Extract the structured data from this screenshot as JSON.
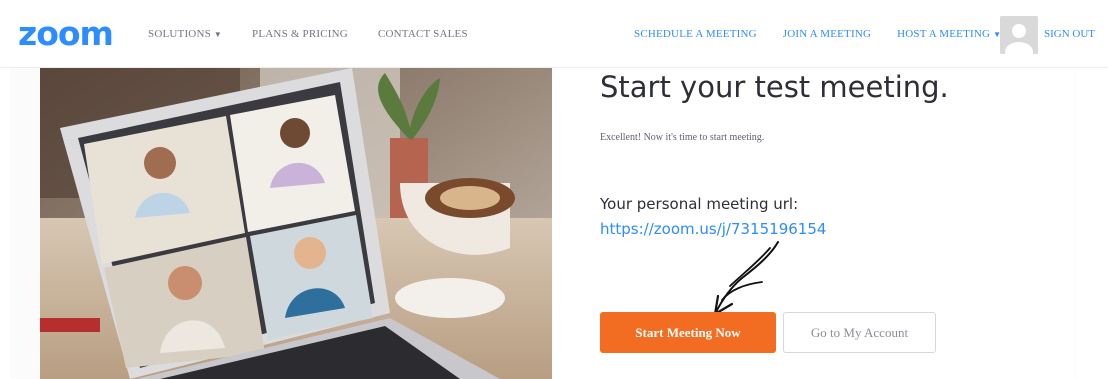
{
  "header": {
    "logo": "zoom",
    "nav_left": [
      {
        "label": "SOLUTIONS",
        "has_caret": true,
        "caret": "▼"
      },
      {
        "label": "PLANS & PRICING"
      },
      {
        "label": "CONTACT SALES"
      }
    ],
    "nav_right": [
      {
        "label": "SCHEDULE A MEETING"
      },
      {
        "label": "JOIN A MEETING"
      },
      {
        "label": "HOST A MEETING",
        "has_caret": true,
        "caret": "▼"
      }
    ],
    "sign_out": "SIGN OUT"
  },
  "main": {
    "title": "Start your test meeting.",
    "subtitle": "Excellent! Now it's time to start meeting.",
    "url_label": "Your personal meeting url:",
    "url": "https://zoom.us/j/7315196154",
    "start_button": "Start Meeting Now",
    "account_button": "Go to My Account"
  },
  "colors": {
    "brand_blue": "#2d8cff",
    "start_orange": "#f26d21"
  },
  "icons": {
    "avatar": "user-avatar-icon",
    "annotation": "handdrawn-arrow-icon"
  }
}
